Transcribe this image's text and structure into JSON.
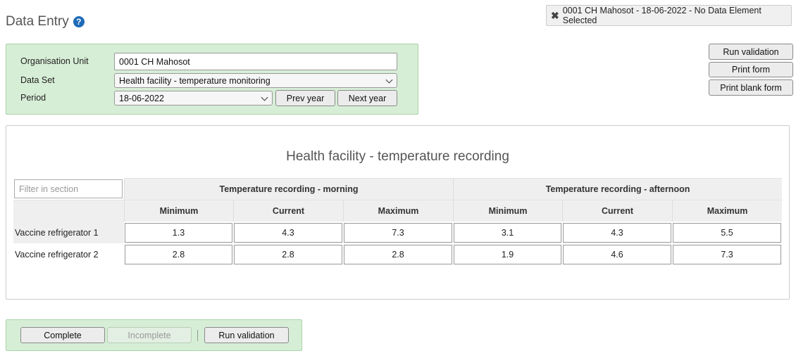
{
  "header": {
    "title": "Data Entry",
    "help_icon": "?"
  },
  "info": {
    "close_icon": "✖",
    "text": "0001 CH Mahosot - 18-06-2022 - No Data Element Selected"
  },
  "selection": {
    "org_unit_label": "Organisation Unit",
    "org_unit_value": "0001 CH Mahosot",
    "dataset_label": "Data Set",
    "dataset_value": "Health facility - temperature monitoring",
    "period_label": "Period",
    "period_value": "18-06-2022",
    "prev_year": "Prev year",
    "next_year": "Next year"
  },
  "side_actions": {
    "run_validation": "Run validation",
    "print_form": "Print form",
    "print_blank_form": "Print blank form"
  },
  "form": {
    "title": "Health facility - temperature recording",
    "filter_placeholder": "Filter in section",
    "groups": [
      "Temperature recording - morning",
      "Temperature recording - afternoon"
    ],
    "columns": [
      "Minimum",
      "Current",
      "Maximum",
      "Minimum",
      "Current",
      "Maximum"
    ],
    "rows": [
      {
        "label": "Vaccine refrigerator 1",
        "values": [
          "1.3",
          "4.3",
          "7.3",
          "3.1",
          "4.3",
          "5.5"
        ]
      },
      {
        "label": "Vaccine refrigerator 2",
        "values": [
          "2.8",
          "2.8",
          "2.8",
          "1.9",
          "4.6",
          "7.3"
        ]
      }
    ]
  },
  "footer": {
    "complete": "Complete",
    "incomplete": "Incomplete",
    "run_validation": "Run validation"
  },
  "colors": {
    "panel_green": "#d7eed6",
    "help_blue": "#1e6bb8"
  }
}
